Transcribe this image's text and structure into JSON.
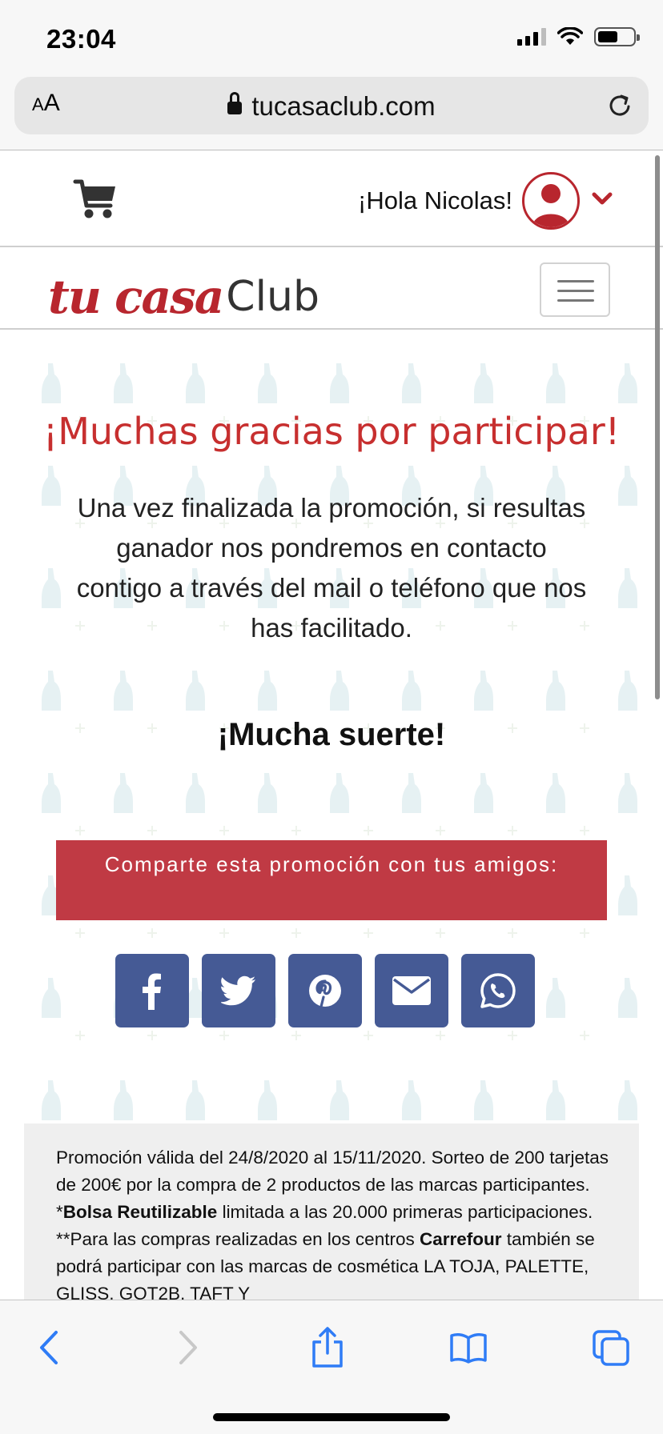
{
  "status_bar": {
    "time": "23:04",
    "icons": [
      "signal-icon",
      "wifi-icon",
      "battery-icon"
    ]
  },
  "browser": {
    "text_size_label": "AA",
    "url": "tucasaclub.com",
    "icons": [
      "lock-icon",
      "reload-icon"
    ]
  },
  "site_header": {
    "greeting": "¡Hola Nicolas!",
    "icons": [
      "cart-icon",
      "user-avatar-icon",
      "chevron-down-icon"
    ]
  },
  "brand": {
    "logo_script": "tu casa",
    "logo_club": "Club",
    "icons": [
      "menu-icon"
    ]
  },
  "content": {
    "title": "¡Muchas gracias por participar!",
    "message": "Una vez finalizada la promoción, si resultas ganador nos pondremos en contacto contigo a través del mail o teléfono que nos has facilitado.",
    "luck": "¡Mucha suerte!",
    "share_label": "Comparte esta promoción con tus amigos:",
    "share_buttons": [
      {
        "name": "facebook",
        "icon": "facebook-icon"
      },
      {
        "name": "twitter",
        "icon": "twitter-icon"
      },
      {
        "name": "pinterest",
        "icon": "pinterest-icon"
      },
      {
        "name": "email",
        "icon": "email-icon"
      },
      {
        "name": "whatsapp",
        "icon": "whatsapp-icon"
      }
    ]
  },
  "legal": {
    "part1": "Promoción válida del 24/8/2020 al 15/11/2020. Sorteo de 200 tarjetas de 200€ por la compra de 2 productos de las marcas participantes. *",
    "bold1": "Bolsa Reutilizable",
    "part2": " limitada a las 20.000 primeras participaciones. **Para las compras realizadas en los centros ",
    "bold2": "Carrefour",
    "part3": " también se podrá participar con las marcas de cosmética LA TOJA, PALETTE, GLISS, GOT2B, TAFT Y"
  },
  "toolbar": {
    "icons": [
      "back-icon",
      "forward-icon",
      "share-icon",
      "bookmarks-icon",
      "tabs-icon"
    ]
  },
  "colors": {
    "brand_red": "#b8262e",
    "title_red": "#c72f2f",
    "share_banner": "#c03a44",
    "share_button": "#455a95",
    "ios_blue": "#2f7cf6"
  }
}
